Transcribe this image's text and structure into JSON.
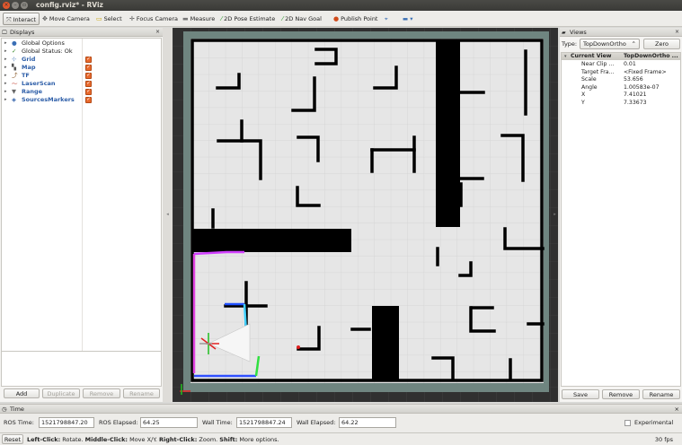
{
  "window": {
    "title": "config.rviz* - RViz"
  },
  "toolbar": {
    "tools": [
      {
        "label": "Interact",
        "icon": "interact-icon",
        "glyph": "⤧",
        "color": "#555555",
        "active": true
      },
      {
        "label": "Move Camera",
        "icon": "move-camera-icon",
        "glyph": "✥",
        "color": "#555555"
      },
      {
        "label": "Select",
        "icon": "select-icon",
        "glyph": "▭",
        "color": "#c9a400"
      },
      {
        "label": "Focus Camera",
        "icon": "focus-camera-icon",
        "glyph": "✛",
        "color": "#555555"
      },
      {
        "label": "Measure",
        "icon": "measure-icon",
        "glyph": "▬",
        "color": "#777777"
      },
      {
        "label": "2D Pose Estimate",
        "icon": "pose-estimate-icon",
        "glyph": "⁄",
        "color": "#2e9a2e"
      },
      {
        "label": "2D Nav Goal",
        "icon": "nav-goal-icon",
        "glyph": "⁄",
        "color": "#2e9a2e"
      },
      {
        "label": "Publish Point",
        "icon": "publish-point-icon",
        "glyph": "●",
        "color": "#d04a1a"
      }
    ]
  },
  "displays": {
    "title": "Displays",
    "items": [
      {
        "label": "Global Options",
        "icon": "globe-icon",
        "glyph": "●",
        "color": "#3a6fb5",
        "blue": false,
        "check": false
      },
      {
        "label": "Global Status: Ok",
        "icon": "check-icon",
        "glyph": "✓",
        "color": "#3b8a2b",
        "blue": false,
        "check": false
      },
      {
        "label": "Grid",
        "icon": "grid-icon",
        "glyph": "⊹",
        "color": "#3a6fb5",
        "blue": true,
        "check": true
      },
      {
        "label": "Map",
        "icon": "map-icon",
        "glyph": "▚",
        "color": "#555555",
        "blue": true,
        "check": true
      },
      {
        "label": "TF",
        "icon": "tf-icon",
        "glyph": "⤴",
        "color": "#8a5a2b",
        "blue": true,
        "check": true
      },
      {
        "label": "LaserScan",
        "icon": "laserscan-icon",
        "glyph": "⁓",
        "color": "#c0392b",
        "blue": true,
        "check": true
      },
      {
        "label": "Range",
        "icon": "range-icon",
        "glyph": "▼",
        "color": "#666666",
        "blue": true,
        "check": true
      },
      {
        "label": "SourcesMarkers",
        "icon": "markers-icon",
        "glyph": "◈",
        "color": "#2d5ea8",
        "blue": true,
        "check": true
      }
    ],
    "buttons": {
      "add": "Add",
      "duplicate": "Duplicate",
      "remove": "Remove",
      "rename": "Rename"
    }
  },
  "views": {
    "title": "Views",
    "type_label": "Type:",
    "type_value": "TopDownOrtho",
    "zero_label": "Zero",
    "header": {
      "key": "Current View",
      "value": "TopDownOrtho ..."
    },
    "props": [
      {
        "key": "Near Clip ...",
        "value": "0.01"
      },
      {
        "key": "Target Fra...",
        "value": "<Fixed Frame>"
      },
      {
        "key": "Scale",
        "value": "53.656"
      },
      {
        "key": "Angle",
        "value": "1.00583e-07"
      },
      {
        "key": "X",
        "value": "7.41021"
      },
      {
        "key": "Y",
        "value": "7.33673"
      }
    ],
    "buttons": {
      "save": "Save",
      "remove": "Remove",
      "rename": "Rename"
    }
  },
  "time": {
    "title": "Time",
    "ros_time_label": "ROS Time:",
    "ros_time": "1521798847.20",
    "ros_elapsed_label": "ROS Elapsed:",
    "ros_elapsed": "64.25",
    "wall_time_label": "Wall Time:",
    "wall_time": "1521798847.24",
    "wall_elapsed_label": "Wall Elapsed:",
    "wall_elapsed": "64.22",
    "experimental": "Experimental"
  },
  "status": {
    "reset": "Reset",
    "hint_b1": "Left-Click:",
    "hint_t1": " Rotate. ",
    "hint_b2": "Middle-Click:",
    "hint_t2": " Move X/Y. ",
    "hint_b3": "Right-Click:",
    "hint_t3": " Zoom. ",
    "hint_b4": "Shift:",
    "hint_t4": " More options.",
    "fps": "30 fps"
  },
  "colors": {
    "accent": "#e9692c",
    "map_bg": "#e6e6e6",
    "wall": "#000000",
    "viewport_bg": "#303030",
    "border_teal": "#6f8580"
  }
}
